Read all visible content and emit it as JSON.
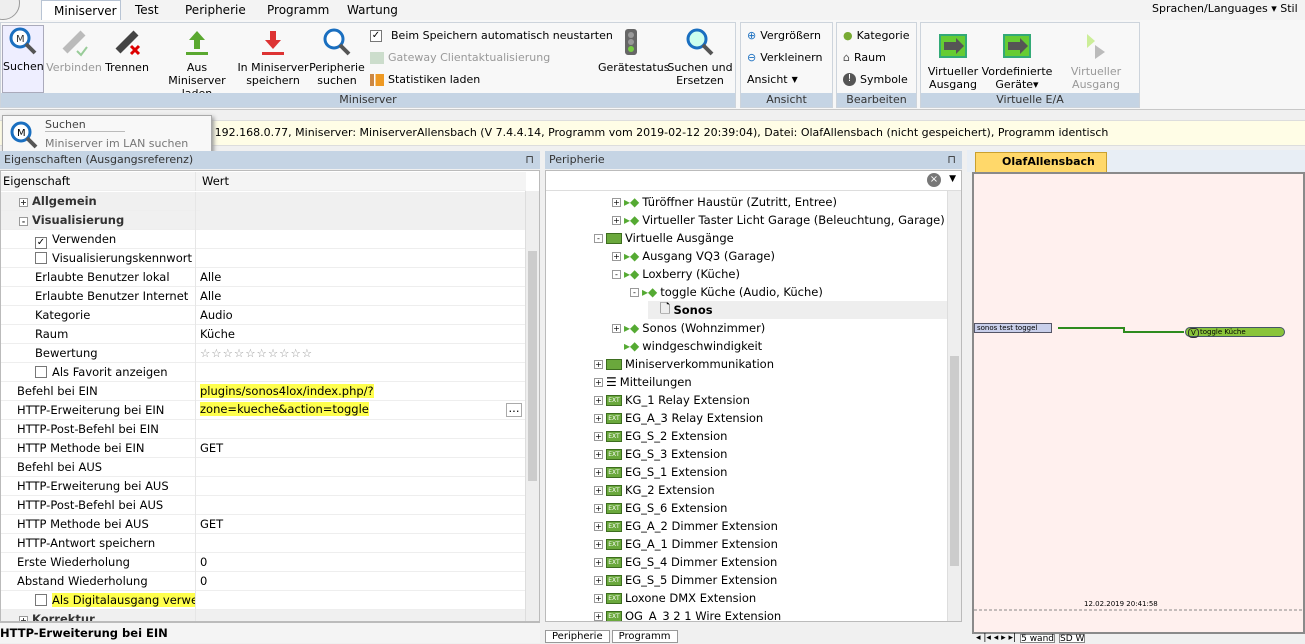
{
  "ribbon": {
    "tabs": [
      "Miniserver",
      "Test",
      "Peripherie",
      "Programm",
      "Wartung"
    ],
    "right_links": [
      "Sprachen/Languages",
      "Stil"
    ],
    "buttons": {
      "suchen": "Suchen",
      "verbinden": "Verbinden",
      "trennen": "Trennen",
      "aus_ms": "Aus Miniserver laden",
      "in_ms": "In Miniserver speichern",
      "peri": "Peripherie suchen",
      "auto_restart": "Beim Speichern automatisch neustarten",
      "gateway": "Gateway Clientaktualisierung",
      "stats": "Statistiken laden",
      "status": "Gerätestatus",
      "replace": "Suchen und Ersetzen",
      "zoom_in": "Vergrößern",
      "zoom_out": "Verkleinern",
      "view": "Ansicht",
      "kategorie": "Kategorie",
      "raum": "Raum",
      "symbole": "Symbole",
      "virt_out": "Virtueller Ausgang",
      "predef": "Vordefinierte Geräte",
      "virt_cmd": "Virtueller Ausgang Befehl"
    },
    "groups": {
      "miniserver": "Miniserver",
      "ansicht": "Ansicht",
      "bearbeiten": "Bearbeiten",
      "virtuell": "Virtuelle E/A"
    }
  },
  "popup": {
    "title": "Suchen",
    "desc": "Miniserver im LAN suchen"
  },
  "status": "Verbunden mit 192.168.0.77, Miniserver: MiniserverAllensbach (V 7.4.4.14, Programm vom 2019-02-12 20:39:04), Datei: OlafAllensbach (nicht gespeichert), Programm identisch",
  "props": {
    "title": "Eigenschaften (Ausgangsreferenz)",
    "col_key": "Eigenschaft",
    "col_val": "Wert",
    "rating_stars": 10,
    "rows": [
      {
        "k": "Allgemein",
        "type": "cat",
        "exp": "+"
      },
      {
        "k": "Visualisierung",
        "type": "cat",
        "exp": "-"
      },
      {
        "k": "Verwenden",
        "type": "check",
        "checked": true
      },
      {
        "k": "Visualisierungskennwort",
        "type": "check",
        "checked": false
      },
      {
        "k": "Erlaubte Benutzer lokal",
        "v": "Alle"
      },
      {
        "k": "Erlaubte Benutzer Internet",
        "v": "Alle"
      },
      {
        "k": "Kategorie",
        "v": "Audio"
      },
      {
        "k": "Raum",
        "v": "Küche"
      },
      {
        "k": "Bewertung",
        "type": "stars"
      },
      {
        "k": "Als Favorit anzeigen",
        "type": "check",
        "checked": false
      },
      {
        "k": "Befehl bei EIN",
        "v": "plugins/sonos4lox/index.php/?zone=kueche&action=toggle",
        "hl": true,
        "top": true
      },
      {
        "k": "HTTP-Erweiterung bei EIN",
        "v": "",
        "top": true,
        "sel": true
      },
      {
        "k": "HTTP-Post-Befehl bei EIN",
        "v": "",
        "top": true
      },
      {
        "k": "HTTP Methode bei EIN",
        "v": "GET",
        "top": true
      },
      {
        "k": "Befehl bei AUS",
        "v": "",
        "top": true
      },
      {
        "k": "HTTP-Erweiterung bei AUS",
        "v": "",
        "top": true
      },
      {
        "k": "HTTP-Post-Befehl bei AUS",
        "v": "",
        "top": true
      },
      {
        "k": "HTTP Methode bei AUS",
        "v": "GET",
        "top": true
      },
      {
        "k": "HTTP-Antwort speichern",
        "v": "",
        "top": true
      },
      {
        "k": "Erste Wiederholung",
        "v": "0",
        "top": true
      },
      {
        "k": "Abstand Wiederholung",
        "v": "0",
        "top": true
      },
      {
        "k": "Als Digitalausgang verwend...",
        "type": "check",
        "checked": false,
        "hl": true
      },
      {
        "k": "Korrektur",
        "type": "cat",
        "exp": "+"
      }
    ],
    "footer": "HTTP-Erweiterung bei EIN"
  },
  "tree": {
    "title": "Peripherie",
    "bottom_tabs": [
      "Peripherie",
      "Programm"
    ],
    "items": [
      {
        "t": "Türöffner Haustür (Zutritt, Entree)",
        "l": 2,
        "i": "vi"
      },
      {
        "t": "Virtueller Taster Licht Garage (Beleuchtung, Garage)",
        "l": 2,
        "i": "vi"
      },
      {
        "t": "Virtuelle Ausgänge",
        "l": 1,
        "i": "grp",
        "exp": "-"
      },
      {
        "t": "Ausgang VQ3 (Garage)",
        "l": 2,
        "i": "vi"
      },
      {
        "t": "Loxberry (Küche)",
        "l": 2,
        "i": "vi",
        "exp": "-"
      },
      {
        "t": "toggle Küche (Audio, Küche)",
        "l": 3,
        "i": "vi",
        "exp": "-"
      },
      {
        "t": "Sonos",
        "l": 4,
        "i": "doc",
        "bold": true
      },
      {
        "t": "Sonos (Wohnzimmer)",
        "l": 2,
        "i": "vi"
      },
      {
        "t": "windgeschwindigkeit",
        "l": 2,
        "i": "vi",
        "noexp": true
      },
      {
        "t": "Miniserverkommunikation",
        "l": 1,
        "i": "grp"
      },
      {
        "t": "Mitteilungen",
        "l": 1,
        "i": "list"
      },
      {
        "t": "KG_1 Relay Extension",
        "l": 1,
        "i": "ext"
      },
      {
        "t": "EG_A_3 Relay Extension",
        "l": 1,
        "i": "ext"
      },
      {
        "t": "EG_S_2 Extension",
        "l": 1,
        "i": "ext"
      },
      {
        "t": "EG_S_3 Extension",
        "l": 1,
        "i": "ext"
      },
      {
        "t": "EG_S_1 Extension",
        "l": 1,
        "i": "ext"
      },
      {
        "t": "KG_2 Extension",
        "l": 1,
        "i": "ext"
      },
      {
        "t": "EG_S_6 Extension",
        "l": 1,
        "i": "ext"
      },
      {
        "t": "EG_A_2 Dimmer Extension",
        "l": 1,
        "i": "ext"
      },
      {
        "t": "EG_A_1 Dimmer Extension",
        "l": 1,
        "i": "ext"
      },
      {
        "t": "EG_S_4 Dimmer Extension",
        "l": 1,
        "i": "ext"
      },
      {
        "t": "EG_S_5 Dimmer Extension",
        "l": 1,
        "i": "ext"
      },
      {
        "t": "Loxone DMX Extension",
        "l": 1,
        "i": "ext"
      },
      {
        "t": "OG_A_3 2 1 Wire Extension",
        "l": 1,
        "i": "ext"
      }
    ]
  },
  "canvas": {
    "tab": "OlafAllensbach",
    "input_block": "sonos test toggel",
    "output_block": "toggle Küche",
    "output_badge": "V",
    "timestamp": "12.02.2019 20:41:58",
    "sheet_tabs": [
      "5 wand",
      "SD W"
    ],
    "wire_color": "#2e8b1e",
    "bg": "#fff0ee"
  }
}
